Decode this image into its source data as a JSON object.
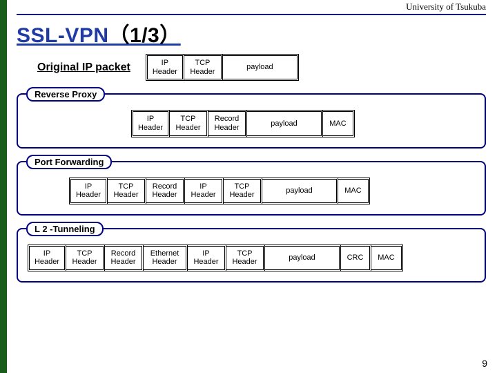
{
  "header": {
    "institution": "University of Tsukuba"
  },
  "title": {
    "main": "SSL-VPN",
    "paren": "（1/3）"
  },
  "original": {
    "label": "Original  IP packet",
    "cells": [
      "IP Header",
      "TCP Header",
      "payload"
    ]
  },
  "sections": [
    {
      "name": "Reverse Proxy",
      "row_class": "row-reverse",
      "cells": [
        {
          "text": "IP Header",
          "w": "w60"
        },
        {
          "text": "TCP Header",
          "w": "w60"
        },
        {
          "text": "Record Header",
          "w": "w60"
        },
        {
          "text": "payload",
          "w": "w-pay"
        },
        {
          "text": "MAC",
          "w": "w-mac"
        }
      ]
    },
    {
      "name": "Port Forwarding",
      "row_class": "row-portfwd",
      "cells": [
        {
          "text": "IP Header",
          "w": "w60"
        },
        {
          "text": "TCP Header",
          "w": "w60"
        },
        {
          "text": "Record Header",
          "w": "w60"
        },
        {
          "text": "IP Header",
          "w": "w60"
        },
        {
          "text": "TCP Header",
          "w": "w60"
        },
        {
          "text": "payload",
          "w": "w-pay"
        },
        {
          "text": "MAC",
          "w": "w-mac"
        }
      ]
    },
    {
      "name": "L 2 -Tunneling",
      "row_class": "row-l2",
      "cells": [
        {
          "text": "IP Header",
          "w": "w60"
        },
        {
          "text": "TCP Header",
          "w": "w60"
        },
        {
          "text": "Record Header",
          "w": "w60"
        },
        {
          "text": "Ethernet Header",
          "w": "w70"
        },
        {
          "text": "IP Header",
          "w": "w60"
        },
        {
          "text": "TCP Header",
          "w": "w60"
        },
        {
          "text": "payload",
          "w": "w-pay2"
        },
        {
          "text": "CRC",
          "w": "w-crc"
        },
        {
          "text": "MAC",
          "w": "w-mac"
        }
      ]
    }
  ],
  "page_number": "9"
}
